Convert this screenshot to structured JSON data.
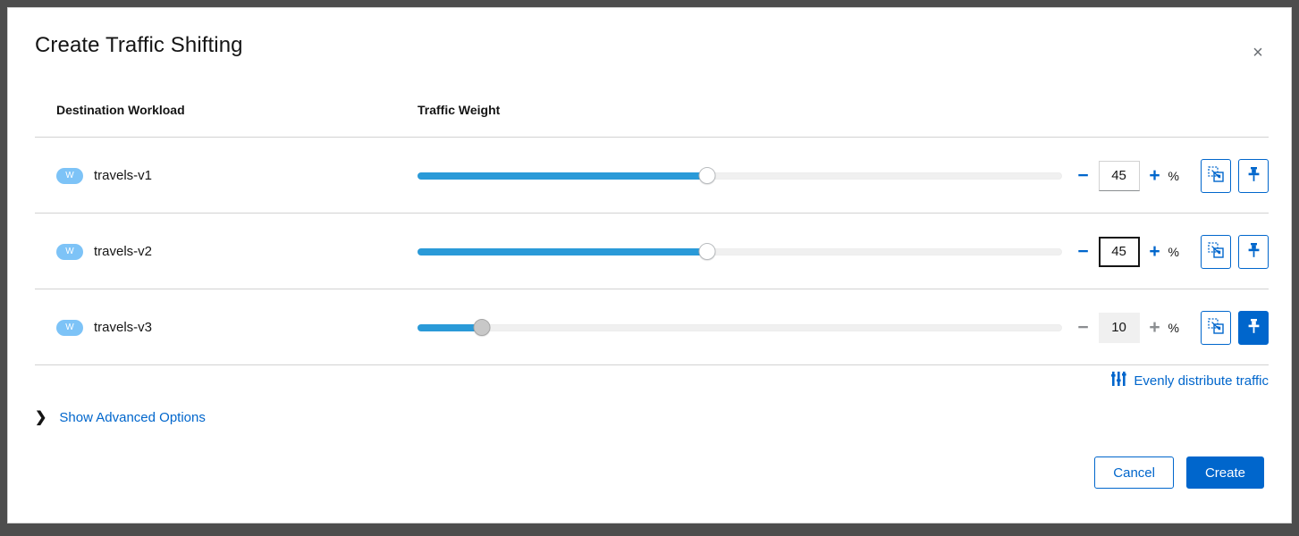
{
  "dialog": {
    "title": "Create Traffic Shifting",
    "close_icon": "close-icon",
    "close_label": "×"
  },
  "table": {
    "headers": {
      "destination": "Destination Workload",
      "weight": "Traffic Weight"
    },
    "rows": [
      {
        "badge": "W",
        "name": "travels-v1",
        "weight": 45,
        "weight_text": "45",
        "percent_label": "%",
        "minus_label": "−",
        "plus_label": "+",
        "input_focused": false,
        "disabled": false,
        "pinned": false,
        "clone_icon": "clone-icon",
        "pin_icon": "pin-icon"
      },
      {
        "badge": "W",
        "name": "travels-v2",
        "weight": 45,
        "weight_text": "45",
        "percent_label": "%",
        "minus_label": "−",
        "plus_label": "+",
        "input_focused": true,
        "disabled": false,
        "pinned": false,
        "clone_icon": "clone-icon",
        "pin_icon": "pin-icon"
      },
      {
        "badge": "W",
        "name": "travels-v3",
        "weight": 10,
        "weight_text": "10",
        "percent_label": "%",
        "minus_label": "−",
        "plus_label": "+",
        "input_focused": false,
        "disabled": true,
        "pinned": true,
        "clone_icon": "clone-icon",
        "pin_icon": "pin-icon"
      }
    ]
  },
  "evenly_distribute": {
    "label": "Evenly distribute traffic",
    "icon": "sliders-icon"
  },
  "advanced": {
    "chevron": "❯",
    "label": "Show Advanced Options"
  },
  "footer": {
    "cancel_label": "Cancel",
    "create_label": "Create"
  },
  "colors": {
    "accent": "#0066cc",
    "slider_fill": "#2a9ad8",
    "badge": "#7dc3f7",
    "backdrop": "#4d4d4d",
    "text": "#151515"
  }
}
